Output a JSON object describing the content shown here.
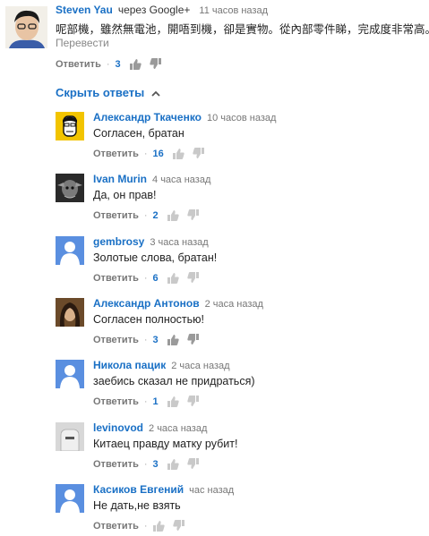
{
  "top_comment": {
    "author": "Steven Yau",
    "via": "через Google+",
    "time": "11 часов назад",
    "text": "呢部機，雖然無電池，開唔到機，卻是實物。從內部零件睇，完成度非常高。",
    "translate": "Перевести",
    "reply_label": "Ответить",
    "separator": "·",
    "likes": "3"
  },
  "replies_toggle": {
    "label": "Скрыть ответы"
  },
  "replies": [
    {
      "author": "Александр Ткаченко",
      "time": "10 часов назад",
      "text": "Согласен, братан",
      "reply_label": "Ответить",
      "separator": "·",
      "likes": "16"
    },
    {
      "author": "Ivan Murin",
      "time": "4 часа назад",
      "text": "Да, он прав!",
      "reply_label": "Ответить",
      "separator": "·",
      "likes": "2"
    },
    {
      "author": "gembrosy",
      "time": "3 часа назад",
      "text": "Золотые слова, братан!",
      "reply_label": "Ответить",
      "separator": "·",
      "likes": "6"
    },
    {
      "author": "Александр Антонов",
      "time": "2 часа назад",
      "text": "Согласен полностью!",
      "reply_label": "Ответить",
      "separator": "·",
      "likes": "3"
    },
    {
      "author": "Никола пацик",
      "time": "2 часа назад",
      "text": "заебись сказал не придраться)",
      "reply_label": "Ответить",
      "separator": "·",
      "likes": "1"
    },
    {
      "author": "levinovod",
      "time": "2 часа назад",
      "text": "Китаец правду матку рубит!",
      "reply_label": "Ответить",
      "separator": "·",
      "likes": "3"
    },
    {
      "author": "Касиков Евгений",
      "time": "час назад",
      "text": "Не дать,не взять",
      "reply_label": "Ответить",
      "separator": "·",
      "likes": ""
    }
  ],
  "icons": {
    "like": "thumb-up-icon",
    "dislike": "thumb-down-icon",
    "chevron": "chevron-up-icon"
  },
  "colors": {
    "link_blue": "#1a70c5",
    "meta_gray": "#777777",
    "default_avatar_blue": "#5a8fe0"
  }
}
